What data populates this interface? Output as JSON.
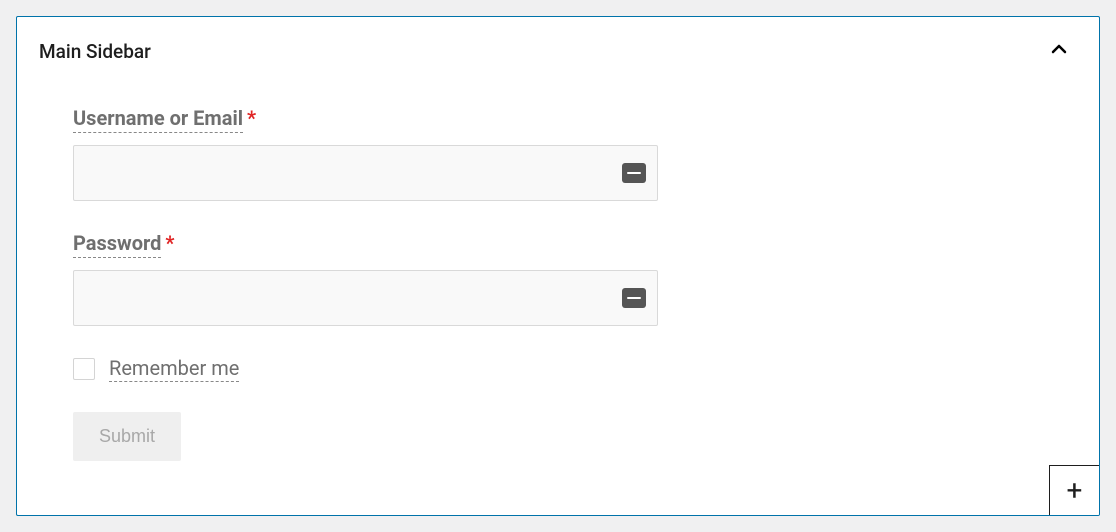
{
  "panel": {
    "title": "Main Sidebar"
  },
  "form": {
    "username": {
      "label": "Username or Email",
      "required": "*",
      "value": ""
    },
    "password": {
      "label": "Password",
      "required": "*",
      "value": ""
    },
    "remember": {
      "label": "Remember me",
      "checked": false
    },
    "submit": {
      "label": "Submit"
    }
  },
  "addBlock": {
    "symbol": "+"
  }
}
